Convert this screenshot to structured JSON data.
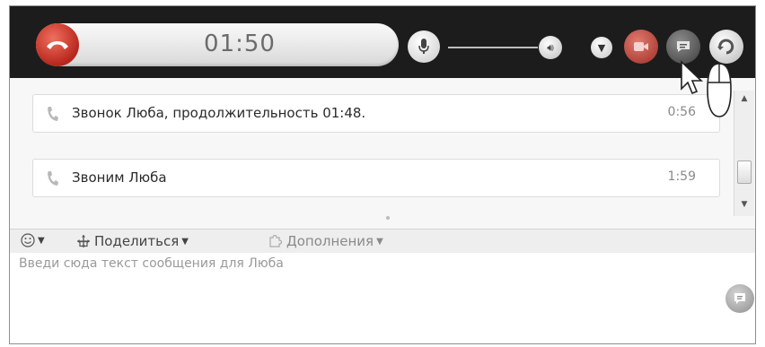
{
  "callbar": {
    "timer": "01:50",
    "buttons": [
      "hangup",
      "mute-microphone",
      "volume",
      "options",
      "video",
      "chat",
      "reconnect"
    ]
  },
  "colors": {
    "callbar_bg": "#1c1c1c",
    "hangup_red": "#b8261c",
    "text": "#2b2b2b"
  },
  "volume_level": 1.0,
  "messages": [
    {
      "text": "Звонок Люба, продолжительность 01:48.",
      "time": "0:56",
      "icon": "phone-icon"
    },
    {
      "text": "Звоним Люба",
      "time": "1:59",
      "icon": "phone-icon"
    }
  ],
  "toolbar": {
    "emoji_icon": "smiley-icon",
    "share_label": "Поделиться",
    "extras_label": "Дополнения"
  },
  "input": {
    "placeholder": "Введи сюда текст сообщения для Люба"
  }
}
